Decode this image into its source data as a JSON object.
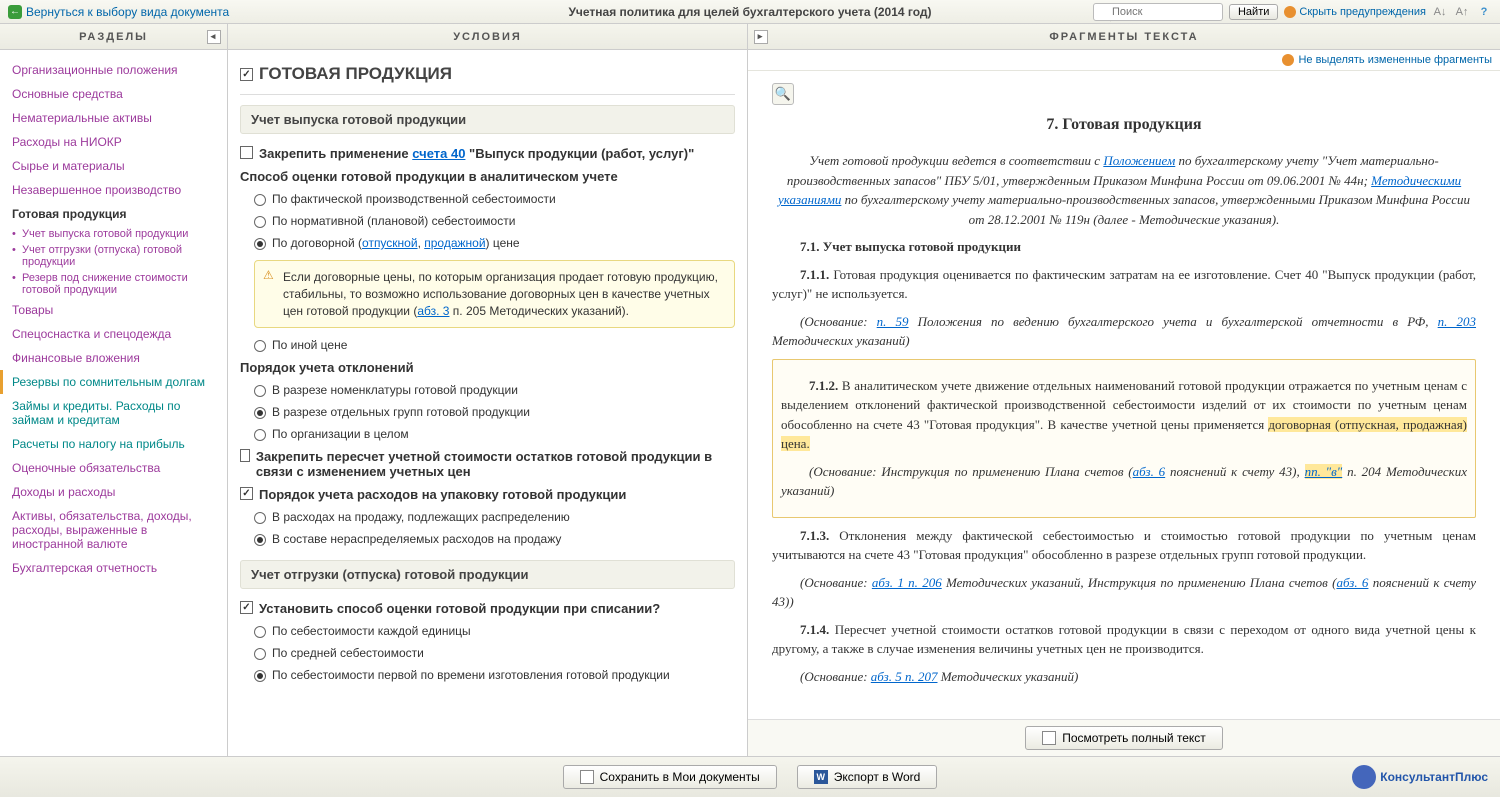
{
  "topbar": {
    "back": "Вернуться к выбору вида документа",
    "title": "Учетная политика для целей бухгалтерского учета (2014 год)",
    "search_placeholder": "Поиск",
    "find": "Найти",
    "hide_warnings": "Скрыть предупреждения"
  },
  "sidebar": {
    "header": "РАЗДЕЛЫ",
    "items": [
      {
        "label": "Организационные положения",
        "cls": "nav-item"
      },
      {
        "label": "Основные средства",
        "cls": "nav-item"
      },
      {
        "label": "Нематериальные активы",
        "cls": "nav-item"
      },
      {
        "label": "Расходы на НИОКР",
        "cls": "nav-item"
      },
      {
        "label": "Сырье и материалы",
        "cls": "nav-item"
      },
      {
        "label": "Незавершенное производство",
        "cls": "nav-item"
      },
      {
        "label": "Готовая продукция",
        "cls": "nav-item active"
      },
      {
        "label": "Учет выпуска готовой продукции",
        "cls": "nav-sub"
      },
      {
        "label": "Учет отгрузки (отпуска) готовой продукции",
        "cls": "nav-sub"
      },
      {
        "label": "Резерв под снижение стоимости готовой продукции",
        "cls": "nav-sub"
      },
      {
        "label": "Товары",
        "cls": "nav-item"
      },
      {
        "label": "Спецоснастка и спецодежда",
        "cls": "nav-item"
      },
      {
        "label": "Финансовые вложения",
        "cls": "nav-item"
      },
      {
        "label": "Резервы по сомнительным долгам",
        "cls": "nav-item teal left-bar"
      },
      {
        "label": "Займы и кредиты. Расходы по займам и кредитам",
        "cls": "nav-item teal"
      },
      {
        "label": "Расчеты по налогу на прибыль",
        "cls": "nav-item teal"
      },
      {
        "label": "Оценочные обязательства",
        "cls": "nav-item"
      },
      {
        "label": "Доходы и расходы",
        "cls": "nav-item"
      },
      {
        "label": "Активы, обязательства, доходы, расходы, выраженные в иностранной валюте",
        "cls": "nav-item"
      },
      {
        "label": "Бухгалтерская отчетность",
        "cls": "nav-item"
      }
    ]
  },
  "conditions": {
    "header": "УСЛОВИЯ",
    "section_title": "ГОТОВАЯ ПРОДУКЦИЯ",
    "sub1": "Учет выпуска готовой продукции",
    "fix_apply_pre": "Закрепить применение ",
    "fix_apply_link": "счета 40",
    "fix_apply_post": " \"Выпуск продукции (работ, услуг)\"",
    "eval_method": "Способ оценки готовой продукции в аналитическом учете",
    "eval_opts": [
      "По фактической производственной себестоимости",
      "По нормативной (плановой) себестоимости"
    ],
    "eval_opt3_pre": "По договорной (",
    "eval_opt3_l1": "отпускной",
    "eval_opt3_mid": ", ",
    "eval_opt3_l2": "продажной",
    "eval_opt3_post": ") цене",
    "warn_text": "Если договорные цены, по которым организация продает готовую продукцию, стабильны, то возможно использование договорных цен в качестве учетных цен готовой продукции (",
    "warn_link": "абз. 3",
    "warn_tail": " п. 205 Методических указаний).",
    "eval_opt4": "По иной цене",
    "dev_order": "Порядок учета отклонений",
    "dev_opts": [
      "В разрезе номенклатуры готовой продукции",
      "В разрезе отдельных групп готовой продукции",
      "По организации в целом"
    ],
    "recalc": "Закрепить пересчет учетной стоимости остатков готовой продукции в связи с изменением учетных цен",
    "pack_order": "Порядок учета расходов на упаковку готовой продукции",
    "pack_opts": [
      "В расходах на продажу, подлежащих распределению",
      "В составе нераспределяемых расходов на продажу"
    ],
    "sub2": "Учет отгрузки (отпуска) готовой продукции",
    "ship_q": "Установить способ оценки готовой продукции при списании?",
    "ship_opts": [
      "По себестоимости каждой единицы",
      "По средней себестоимости",
      "По себестоимости первой по времени изготовления готовой продукции"
    ]
  },
  "fragments": {
    "header": "ФРАГМЕНТЫ ТЕКСТА",
    "tool": "Не выделять измененные фрагменты",
    "title": "7. Готовая продукция",
    "intro_pre": "Учет готовой продукции ведется в соответствии с ",
    "intro_l1": "Положением",
    "intro_mid1": " по бухгалтерскому учету \"Учет материально-производственных запасов\" ПБУ 5/01, утвержденным Приказом Минфина России от 09.06.2001 № 44н; ",
    "intro_l2": "Методическими указаниями",
    "intro_post": " по бухгалтерскому учету материально-производственных запасов, утвержденными Приказом Минфина России от 28.12.2001 № 119н (далее - Методические указания).",
    "p71": "7.1. Учет выпуска готовой продукции",
    "p711": "7.1.1. Готовая продукция оценивается по фактическим затратам на ее изготовление. Счет 40 \"Выпуск продукции (работ, услуг)\" не используется.",
    "b711_pre": "(Основание: ",
    "b711_l1": "п. 59",
    "b711_mid": " Положения по ведению бухгалтерского учета и бухгалтерской отчетности в РФ, ",
    "b711_l2": "п. 203",
    "b711_post": " Методических указаний)",
    "p712_pre": "7.1.2. В аналитическом учете движение отдельных наименований готовой продукции отражается по учетным ценам с выделением отклонений фактической производственной себестоимости изделий от их стоимости по учетным ценам обособленно на счете 43 \"Готовая продукция\". В качестве учетной цены применяется ",
    "p712_hl": "договорная (отпускная, продажная) цена.",
    "b712_pre": "(Основание: Инструкция по применению Плана счетов (",
    "b712_l1": "абз. 6",
    "b712_mid": " пояснений к счету 43), ",
    "b712_l2": "пп. \"в\"",
    "b712_post": " п. 204 Методических указаний)",
    "p713": "7.1.3. Отклонения между фактической себестоимостью и стоимостью готовой продукции по учетным ценам учитываются на счете 43 \"Готовая продукция\" обособленно в разрезе отдельных групп готовой продукции.",
    "b713_pre": "(Основание: ",
    "b713_l1": "абз. 1 п. 206",
    "b713_mid": " Методических указаний, Инструкция по применению Плана счетов (",
    "b713_l2": "абз. 6",
    "b713_post": " пояснений к счету 43))",
    "p714": "7.1.4. Пересчет учетной стоимости остатков готовой продукции в связи с переходом от одного вида учетной цены к другому, а также в случае изменения величины учетных цен не производится.",
    "b714_pre": "(Основание: ",
    "b714_l1": "абз. 5 п. 207",
    "b714_post": " Методических указаний)",
    "view_full": "Посмотреть полный текст"
  },
  "footer": {
    "save": "Сохранить в Мои документы",
    "export": "Экспорт в Word",
    "brand": "КонсультантПлюс"
  }
}
